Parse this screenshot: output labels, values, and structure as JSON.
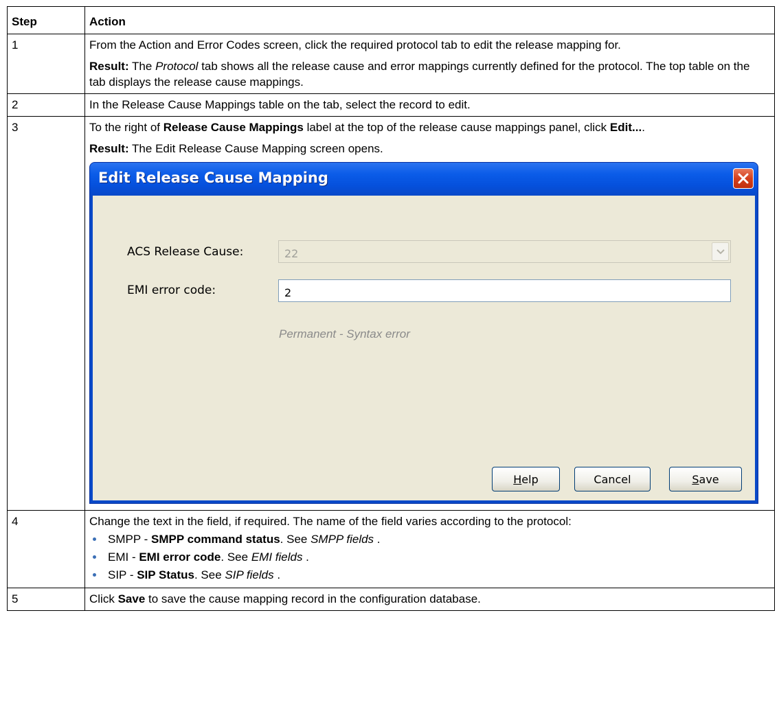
{
  "table": {
    "header": {
      "step": "Step",
      "action": "Action"
    },
    "rows": [
      {
        "step": "1",
        "p1": "From the Action and Error Codes screen, click the required protocol tab to edit the release mapping for.",
        "result_label": "Result:",
        "result_pre": "The",
        "result_italic": "Protocol",
        "result_post": "tab shows all the release cause and error mappings currently defined for the protocol. The top table on the tab displays the release cause mappings."
      },
      {
        "step": "2",
        "p1": "In the Release Cause Mappings table on the tab, select the record to edit."
      },
      {
        "step": "3",
        "p1_pre": "To the right of",
        "p1_bold": "Release Cause Mappings",
        "p1_mid": "label at the top of the release cause mappings panel, click",
        "p1_bold2": "Edit...",
        "p1_post": ".",
        "result_label": "Result:",
        "result_text": "The Edit Release Cause Mapping screen opens."
      },
      {
        "step": "4",
        "p1": "Change the text in the field, if required. The name of the field varies according to the protocol:",
        "bullets": [
          {
            "pre": "SMPP - ",
            "bold": "SMPP command status",
            "mid": ". See ",
            "italic": "SMPP fields",
            "post": " ."
          },
          {
            "pre": "EMI - ",
            "bold": "EMI error code",
            "mid": ". See ",
            "italic": "EMI fields",
            "post": " ."
          },
          {
            "pre": "SIP - ",
            "bold": "SIP Status",
            "mid": ". See ",
            "italic": "SIP fields",
            "post": " ."
          }
        ]
      },
      {
        "step": "5",
        "p1_pre": "Click",
        "p1_bold": "Save",
        "p1_post": "to save the cause mapping record in the configuration database."
      }
    ]
  },
  "dialog": {
    "title": "Edit Release Cause Mapping",
    "acs_label": "ACS Release Cause:",
    "acs_value": "22",
    "emi_label": "EMI error code:",
    "emi_value": "2",
    "hint": "Permanent - Syntax error",
    "help_label": "Help",
    "help_mnemonic": "H",
    "cancel_label": "Cancel",
    "save_label": "Save",
    "save_mnemonic": "S",
    "close_icon": "close-icon",
    "dropdown_icon": "chevron-down-icon",
    "colors": {
      "title_bar": "#0a55e0",
      "dialog_body": "#ece9d8",
      "close_button": "#d4401c",
      "bullet": "#3b6fb6"
    }
  }
}
